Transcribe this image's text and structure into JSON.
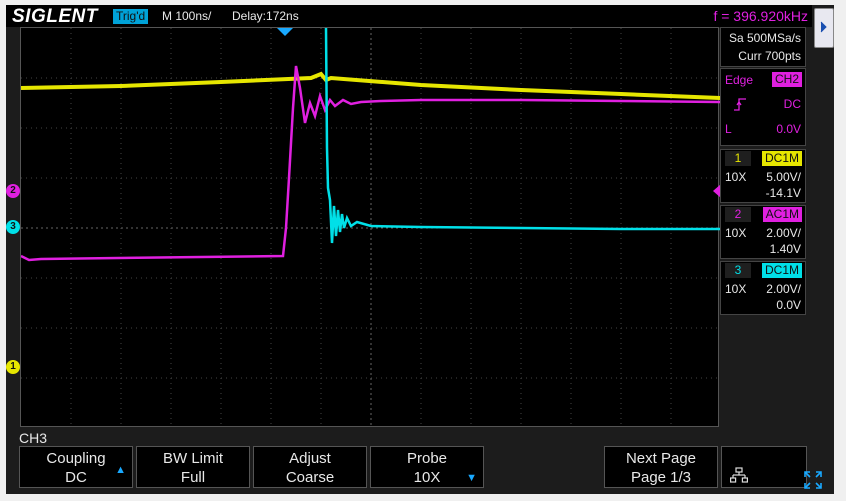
{
  "header": {
    "brand": "SIGLENT",
    "trigger_status": "Trig'd",
    "timebase": "M 100ns/",
    "delay": "Delay:172ns",
    "frequency": "f = 396.920kHz"
  },
  "acquisition": {
    "sample_rate": "Sa 500MSa/s",
    "memory": "Curr 700pts"
  },
  "trigger": {
    "type": "Edge",
    "source": "CH2",
    "coupling": "DC",
    "level_label": "L",
    "level": "0.0V"
  },
  "channels": [
    {
      "number": "1",
      "coupling": "DC1M",
      "probe": "10X",
      "scale": "5.00V/",
      "offset": "-14.1V",
      "color": "#e6e600"
    },
    {
      "number": "2",
      "coupling": "AC1M",
      "probe": "10X",
      "scale": "2.00V/",
      "offset": "1.40V",
      "color": "#e020e0"
    },
    {
      "number": "3",
      "coupling": "DC1M",
      "probe": "10X",
      "scale": "2.00V/",
      "offset": "0.0V",
      "color": "#00e0e8"
    }
  ],
  "menu_title": "CH3",
  "softkeys": [
    {
      "title": "Coupling",
      "value": "DC"
    },
    {
      "title": "BW Limit",
      "value": "Full"
    },
    {
      "title": "Adjust",
      "value": "Coarse"
    },
    {
      "title": "Probe",
      "value": "10X"
    },
    {
      "title": "Next Page",
      "value": "Page 1/3"
    }
  ],
  "icons": {
    "side_menu": "chevron-right-icon",
    "network": "network-icon",
    "fullscreen": "expand-icon"
  }
}
